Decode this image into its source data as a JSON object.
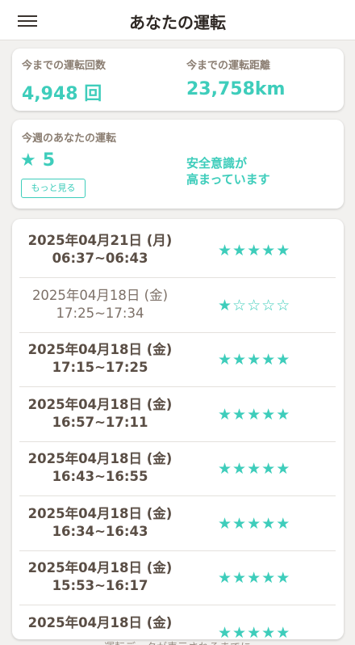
{
  "header": {
    "title": "あなたの運転"
  },
  "stats": {
    "total_count_label": "今までの運転回数",
    "total_count_value": "4,948 回",
    "total_distance_label": "今までの運転距離",
    "total_distance_value": "23,758km"
  },
  "week": {
    "label": "今週のあなたの運転",
    "star_icon": "★",
    "score": "5",
    "more_label": "もっと見る",
    "message": "安全意識が\n高まっています"
  },
  "colors": {
    "accent": "#3ecdbb",
    "text": "#6b5d52",
    "background": "#f2f1ef"
  },
  "drives": [
    {
      "date": "2025年04月21日 (月)",
      "time": "06:37~06:43",
      "stars": 5,
      "light": false
    },
    {
      "date": "2025年04月18日 (金)",
      "time": "17:25~17:34",
      "stars": 1,
      "light": true
    },
    {
      "date": "2025年04月18日 (金)",
      "time": "17:15~17:25",
      "stars": 5,
      "light": false
    },
    {
      "date": "2025年04月18日 (金)",
      "time": "16:57~17:11",
      "stars": 5,
      "light": false
    },
    {
      "date": "2025年04月18日 (金)",
      "time": "16:43~16:55",
      "stars": 5,
      "light": false
    },
    {
      "date": "2025年04月18日 (金)",
      "time": "16:34~16:43",
      "stars": 5,
      "light": false
    },
    {
      "date": "2025年04月18日 (金)",
      "time": "15:53~16:17",
      "stars": 5,
      "light": false
    },
    {
      "date": "2025年04月18日 (金)",
      "time": "",
      "stars": 5,
      "light": false
    }
  ],
  "footer": {
    "note": "運転データが表示されるまでに"
  }
}
